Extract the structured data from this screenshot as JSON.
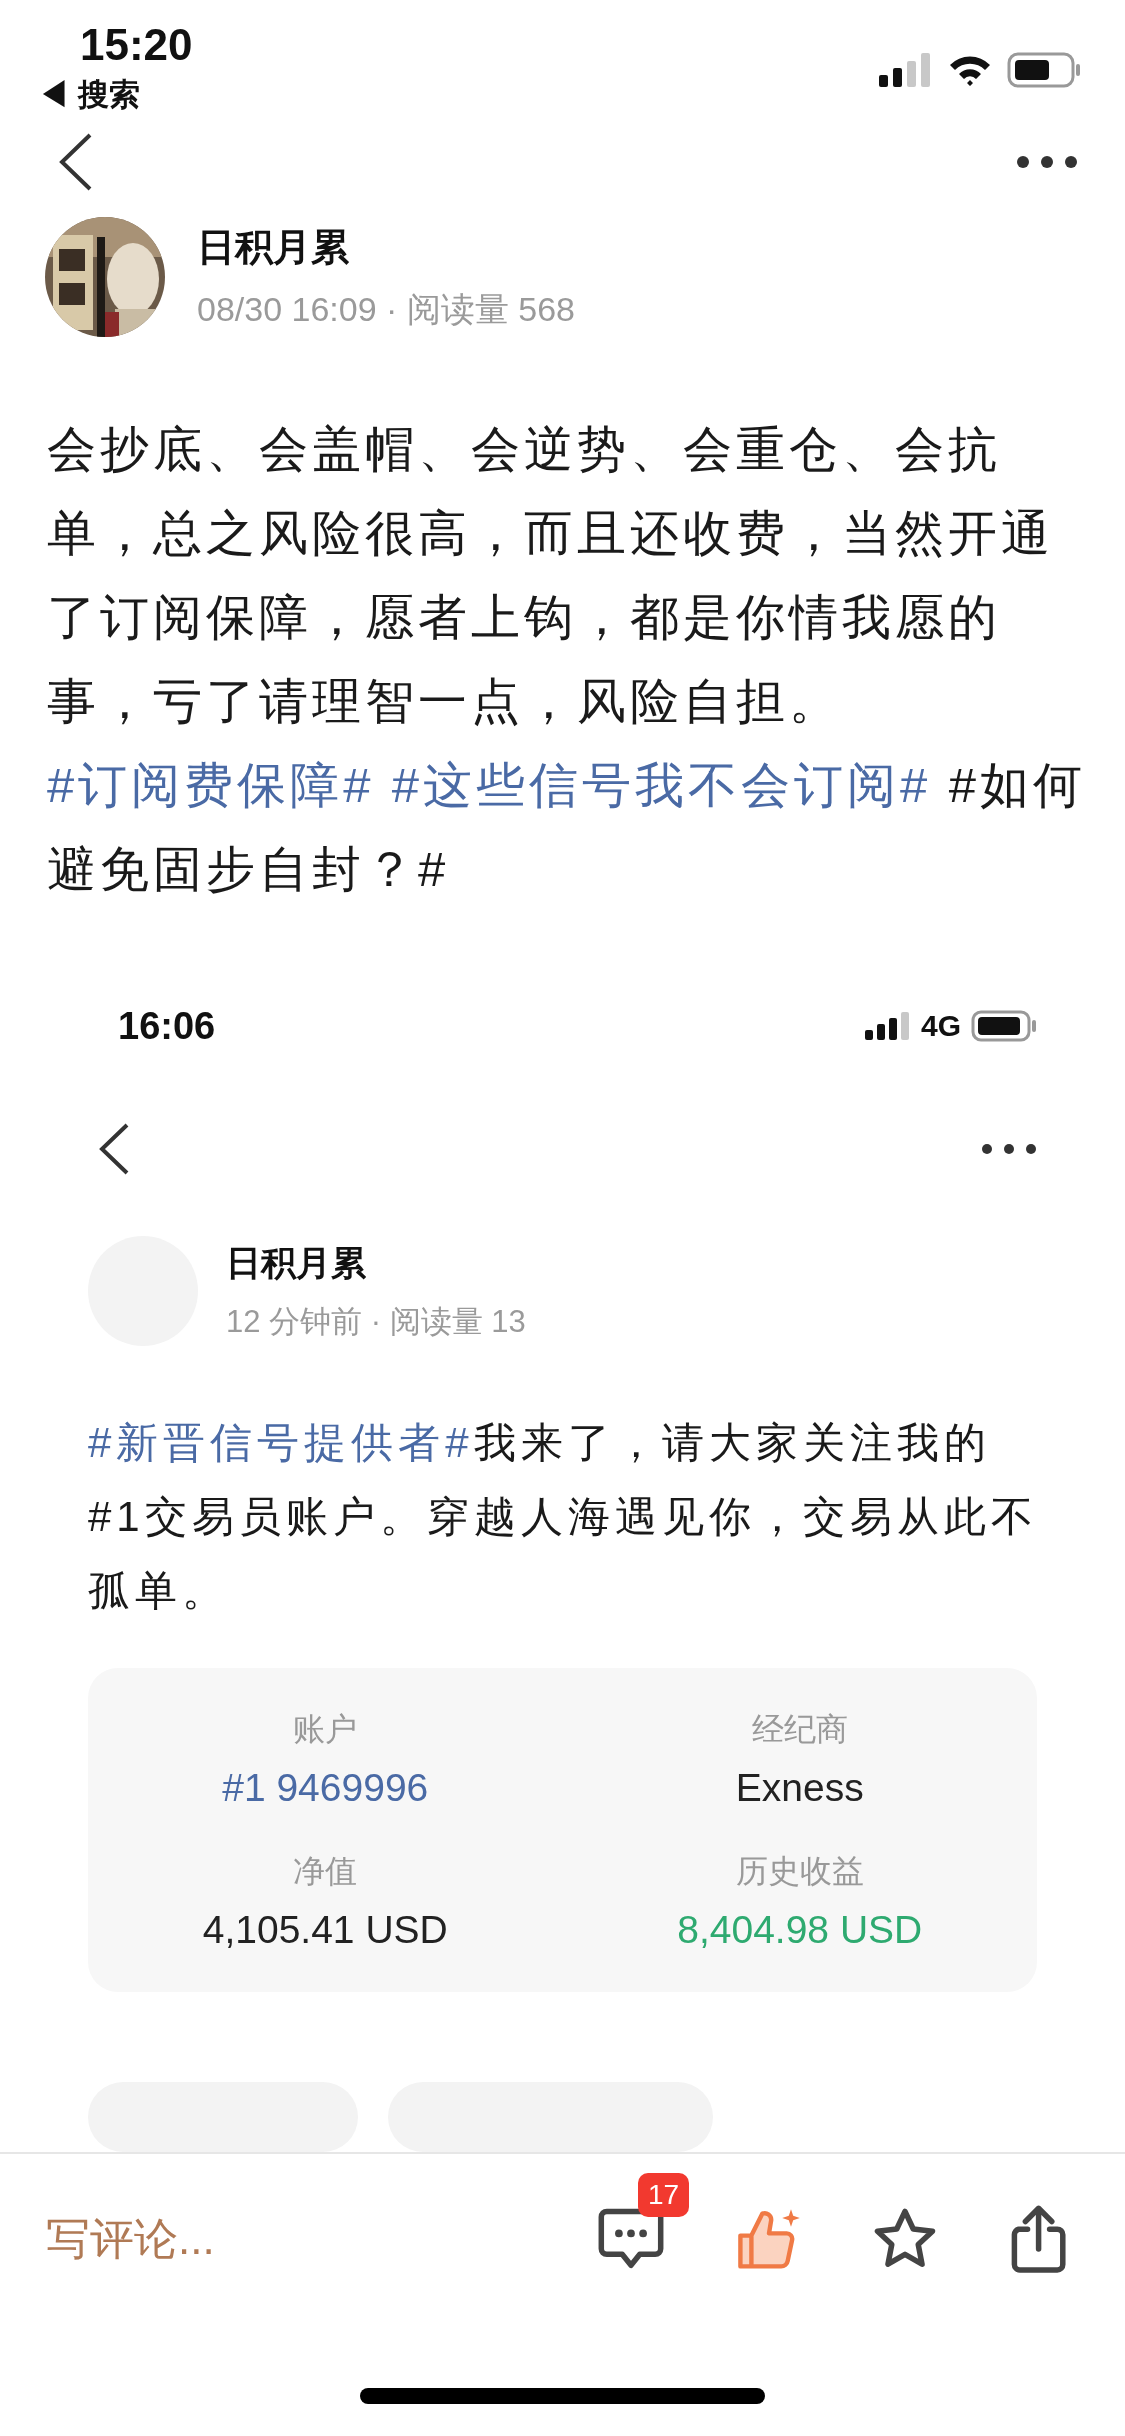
{
  "status_bar": {
    "time": "15:20",
    "back_label": "◀ 搜索"
  },
  "author": {
    "name": "日积月累",
    "meta": "08/30 16:09 · 阅读量 568"
  },
  "post": [
    {
      "kind": "text",
      "text": "会抄底、会盖帽、会逆势、会重仓、会抗单，总之风险很高，而且还收费，当然开通了订阅保障，愿者上钩，都是你情我愿的事，亏了请理智一点，风险自担。 "
    },
    {
      "kind": "hashtag",
      "text": "#订阅费保障#"
    },
    {
      "kind": "hashtag",
      "text": "#这些信号我不会订阅#"
    },
    {
      "kind": "text",
      "text": " #如何避免固步自封？#"
    }
  ],
  "embedded_screenshot": {
    "status_bar": {
      "time": "16:06",
      "network": "4G"
    },
    "author": {
      "name": "日积月累",
      "meta": "12 分钟前 · 阅读量 13"
    },
    "post": [
      {
        "kind": "hashtag",
        "text": "#新晋信号提供者#"
      },
      {
        "kind": "text",
        "text": "我来了，请大家关注我的#1交易员账户。穿越人海遇见你，交易从此不孤单。"
      }
    ],
    "account_card": [
      {
        "label": "账户",
        "value": "#1 9469996",
        "kind": "link"
      },
      {
        "label": "经纪商",
        "value": "Exness",
        "kind": "plain"
      },
      {
        "label": "净值",
        "value": "4,105.41 USD",
        "kind": "plain"
      },
      {
        "label": "历史收益",
        "value": "8,404.98 USD",
        "kind": "positive"
      }
    ]
  },
  "bottom_bar": {
    "comment_placeholder": "写评论...",
    "comment_count": "17",
    "liked": true
  }
}
